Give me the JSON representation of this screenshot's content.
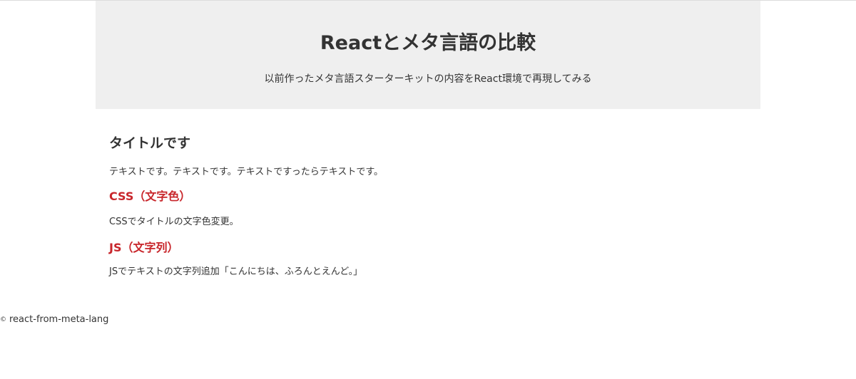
{
  "header": {
    "title": "Reactとメタ言語の比較",
    "subtitle": "以前作ったメタ言語スターターキットの内容をReact環境で再現してみる"
  },
  "main": {
    "heading": "タイトルです",
    "paragraph": "テキストです。テキストです。テキストですったらテキストです。",
    "sections": [
      {
        "title": "CSS（文字色）",
        "text": "CSSでタイトルの文字色変更。"
      },
      {
        "title": "JS（文字列）",
        "text": "JSでテキストの文字列追加「こんにちは、ふろんとえんど。」"
      }
    ]
  },
  "footer": {
    "copyright_symbol": "©",
    "text": "react-from-meta-lang"
  },
  "colors": {
    "accent": "#c8262b",
    "hero_bg": "#efefef",
    "text": "#333333"
  }
}
